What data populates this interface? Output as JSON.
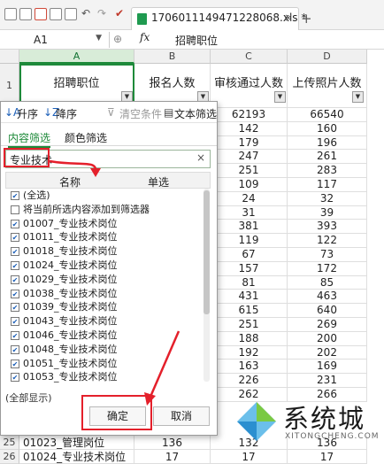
{
  "toolbar": {
    "tab_title": "1706011149471228068.xls *",
    "tab_close": "×",
    "new_tab": "+"
  },
  "formula_bar": {
    "cell_ref": "A1",
    "fx": "fx",
    "content": "招聘职位"
  },
  "columns": [
    "A",
    "B",
    "C",
    "D"
  ],
  "header_row": {
    "num": "1",
    "cells": [
      "招聘职位",
      "报名人数",
      "审核通过人数",
      "上传照片人数"
    ]
  },
  "data_rows": [
    {
      "num": "",
      "c": [
        "62193",
        "66540"
      ]
    },
    {
      "num": "",
      "c": [
        "142",
        "160"
      ]
    },
    {
      "num": "",
      "c": [
        "179",
        "196"
      ]
    },
    {
      "num": "",
      "c": [
        "247",
        "261"
      ]
    },
    {
      "num": "",
      "c": [
        "251",
        "283"
      ]
    },
    {
      "num": "",
      "c": [
        "109",
        "117"
      ]
    },
    {
      "num": "",
      "c": [
        "24",
        "32"
      ]
    },
    {
      "num": "",
      "c": [
        "31",
        "39"
      ]
    },
    {
      "num": "",
      "c": [
        "381",
        "393"
      ]
    },
    {
      "num": "",
      "c": [
        "119",
        "122"
      ]
    },
    {
      "num": "",
      "c": [
        "67",
        "73"
      ]
    },
    {
      "num": "",
      "c": [
        "157",
        "172"
      ]
    },
    {
      "num": "",
      "c": [
        "81",
        "85"
      ]
    },
    {
      "num": "",
      "c": [
        "431",
        "463"
      ]
    },
    {
      "num": "",
      "c": [
        "615",
        "640"
      ]
    },
    {
      "num": "",
      "c": [
        "251",
        "269"
      ]
    },
    {
      "num": "",
      "c": [
        "188",
        "200"
      ]
    },
    {
      "num": "",
      "c": [
        "192",
        "202"
      ]
    },
    {
      "num": "",
      "c": [
        "163",
        "169"
      ]
    },
    {
      "num": "",
      "c": [
        "226",
        "231"
      ]
    },
    {
      "num": "",
      "c": [
        "262",
        "266"
      ]
    }
  ],
  "bottom_rows": [
    {
      "num": "25",
      "a": "01023_管理岗位",
      "b": "136",
      "c": "132",
      "d": "136"
    },
    {
      "num": "26",
      "a": "01024_专业技术岗位",
      "b": "17",
      "c": "17",
      "d": "17"
    }
  ],
  "filter_panel": {
    "sort_asc": "升序",
    "sort_desc": "降序",
    "clear": "清空条件",
    "text_filter": "文本筛选",
    "tab_content": "内容筛选",
    "tab_color": "颜色筛选",
    "search_value": "专业技术",
    "search_clear": "×",
    "col_multi": "名称",
    "col_single": "单选",
    "items": [
      {
        "label": "(全选)",
        "checked": true
      },
      {
        "label": "将当前所选内容添加到筛选器",
        "checked": false
      },
      {
        "label": "01007_专业技术岗位",
        "checked": true
      },
      {
        "label": "01011_专业技术岗位",
        "checked": true
      },
      {
        "label": "01018_专业技术岗位",
        "checked": true
      },
      {
        "label": "01024_专业技术岗位",
        "checked": true
      },
      {
        "label": "01029_专业技术岗位",
        "checked": true
      },
      {
        "label": "01038_专业技术岗位",
        "checked": true
      },
      {
        "label": "01039_专业技术岗位",
        "checked": true
      },
      {
        "label": "01043_专业技术岗位",
        "checked": true
      },
      {
        "label": "01046_专业技术岗位",
        "checked": true
      },
      {
        "label": "01048_专业技术岗位",
        "checked": true
      },
      {
        "label": "01051_专业技术岗位",
        "checked": true
      },
      {
        "label": "01053_专业技术岗位",
        "checked": true
      }
    ],
    "show_all": "(全部显示)",
    "ok": "确定",
    "cancel": "取消"
  },
  "watermark": {
    "brand": "系统城",
    "url": "XITONGCHENG.COM"
  },
  "colors": {
    "accent_green": "#1e8a3a",
    "annotation_red": "#e4202b"
  }
}
